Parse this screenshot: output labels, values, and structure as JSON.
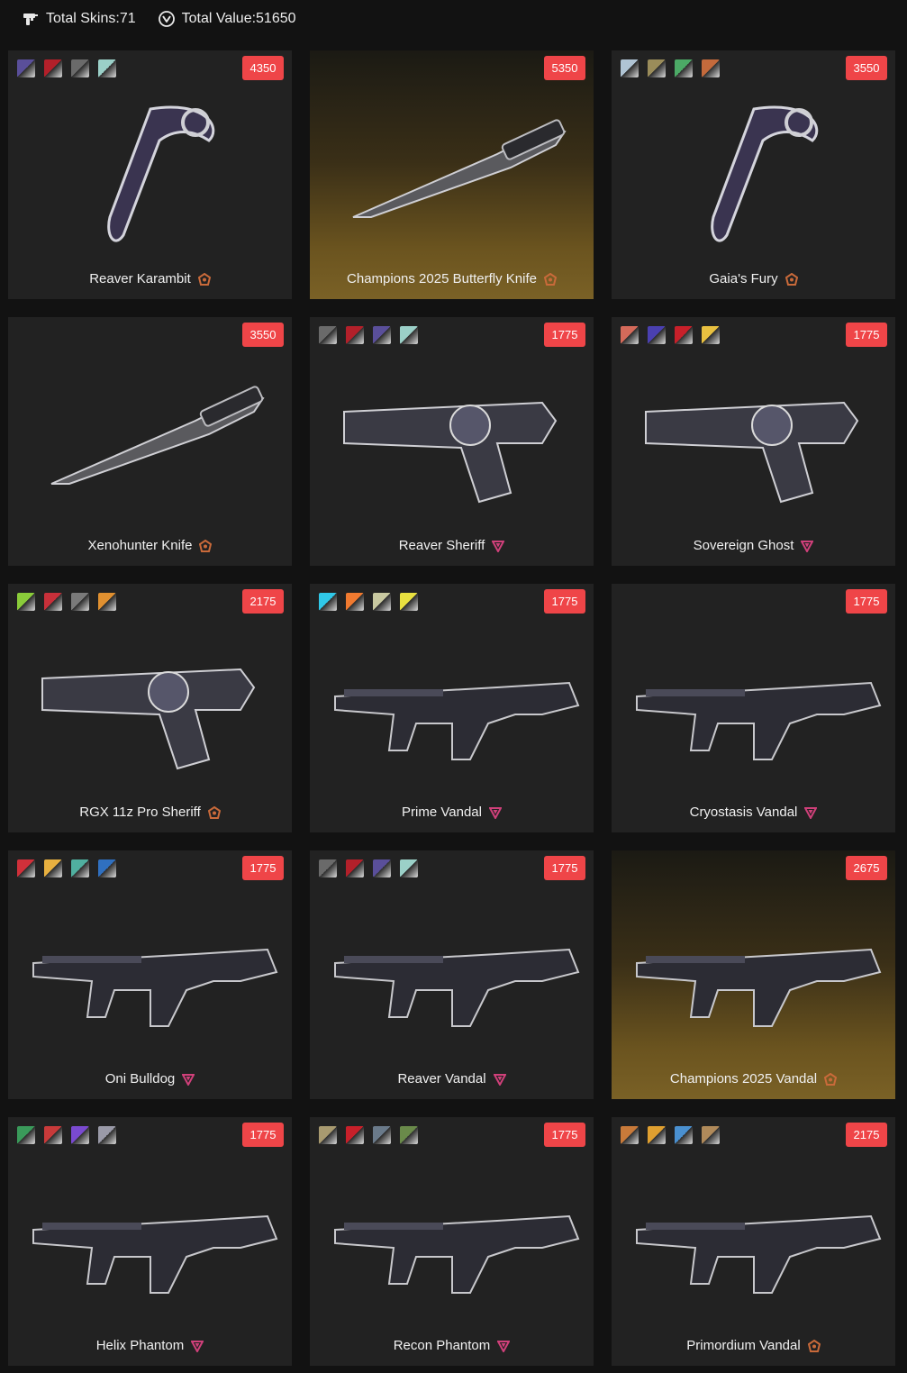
{
  "header": {
    "total_skins": "Total Skins:71",
    "total_value": "Total Value:51650"
  },
  "colors": {
    "price_badge": "#ef4548",
    "card_bg": "#222222",
    "exclusive_tier": "#c96a3a",
    "premium_tier": "#d0407a"
  },
  "cards": [
    {
      "name": "Reaver Karambit",
      "price": "4350",
      "tier": "exclusive-tier-icon",
      "gold": false,
      "chromas": [
        "#5a4f9a",
        "#b3202a",
        "#6a6a6a",
        "#9bd0c8"
      ]
    },
    {
      "name": "Champions 2025 Butterfly Knife",
      "price": "5350",
      "tier": "exclusive-tier-icon",
      "gold": true,
      "chromas": []
    },
    {
      "name": "Gaia's Fury",
      "price": "3550",
      "tier": "exclusive-tier-icon",
      "gold": false,
      "chromas": [
        "#b0c4d4",
        "#9a8c5a",
        "#4caa66",
        "#c46a3c"
      ]
    },
    {
      "name": "Xenohunter Knife",
      "price": "3550",
      "tier": "exclusive-tier-icon",
      "gold": false,
      "chromas": []
    },
    {
      "name": "Reaver Sheriff",
      "price": "1775",
      "tier": "premium-tier-icon",
      "gold": false,
      "chromas": [
        "#6a6a6a",
        "#b3202a",
        "#5a4f9a",
        "#9bd0c8"
      ]
    },
    {
      "name": "Sovereign Ghost",
      "price": "1775",
      "tier": "premium-tier-icon",
      "gold": false,
      "chromas": [
        "#d46a5a",
        "#4a40b0",
        "#c8202a",
        "#e8c040"
      ]
    },
    {
      "name": "RGX 11z Pro Sheriff",
      "price": "2175",
      "tier": "exclusive-tier-icon",
      "gold": false,
      "chromas": [
        "#8acc3a",
        "#c8303a",
        "#7a7a7a",
        "#e09030"
      ]
    },
    {
      "name": "Prime Vandal",
      "price": "1775",
      "tier": "premium-tier-icon",
      "gold": false,
      "chromas": [
        "#30c8e8",
        "#f07a30",
        "#c8c8a0",
        "#e8e040"
      ]
    },
    {
      "name": "Cryostasis Vandal",
      "price": "1775",
      "tier": "premium-tier-icon",
      "gold": false,
      "chromas": []
    },
    {
      "name": "Oni Bulldog",
      "price": "1775",
      "tier": "premium-tier-icon",
      "gold": false,
      "chromas": [
        "#d0303a",
        "#e8b040",
        "#50b0a0",
        "#3070c0"
      ]
    },
    {
      "name": "Reaver Vandal",
      "price": "1775",
      "tier": "premium-tier-icon",
      "gold": false,
      "chromas": [
        "#6a6a6a",
        "#b3202a",
        "#5a4f9a",
        "#9bd0c8"
      ]
    },
    {
      "name": "Champions 2025 Vandal",
      "price": "2675",
      "tier": "exclusive-tier-icon",
      "gold": true,
      "chromas": []
    },
    {
      "name": "Helix Phantom",
      "price": "1775",
      "tier": "premium-tier-icon",
      "gold": false,
      "chromas": [
        "#3a9a5a",
        "#c83a3a",
        "#7a4ad0",
        "#9a9aa8"
      ]
    },
    {
      "name": "Recon Phantom",
      "price": "1775",
      "tier": "premium-tier-icon",
      "gold": false,
      "chromas": [
        "#a89a70",
        "#c8202a",
        "#6a7a8a",
        "#6a8a4a"
      ]
    },
    {
      "name": "Primordium Vandal",
      "price": "2175",
      "tier": "exclusive-tier-icon",
      "gold": false,
      "chromas": [
        "#c87a3a",
        "#e0a030",
        "#4a90d0",
        "#b08a5a"
      ]
    }
  ]
}
